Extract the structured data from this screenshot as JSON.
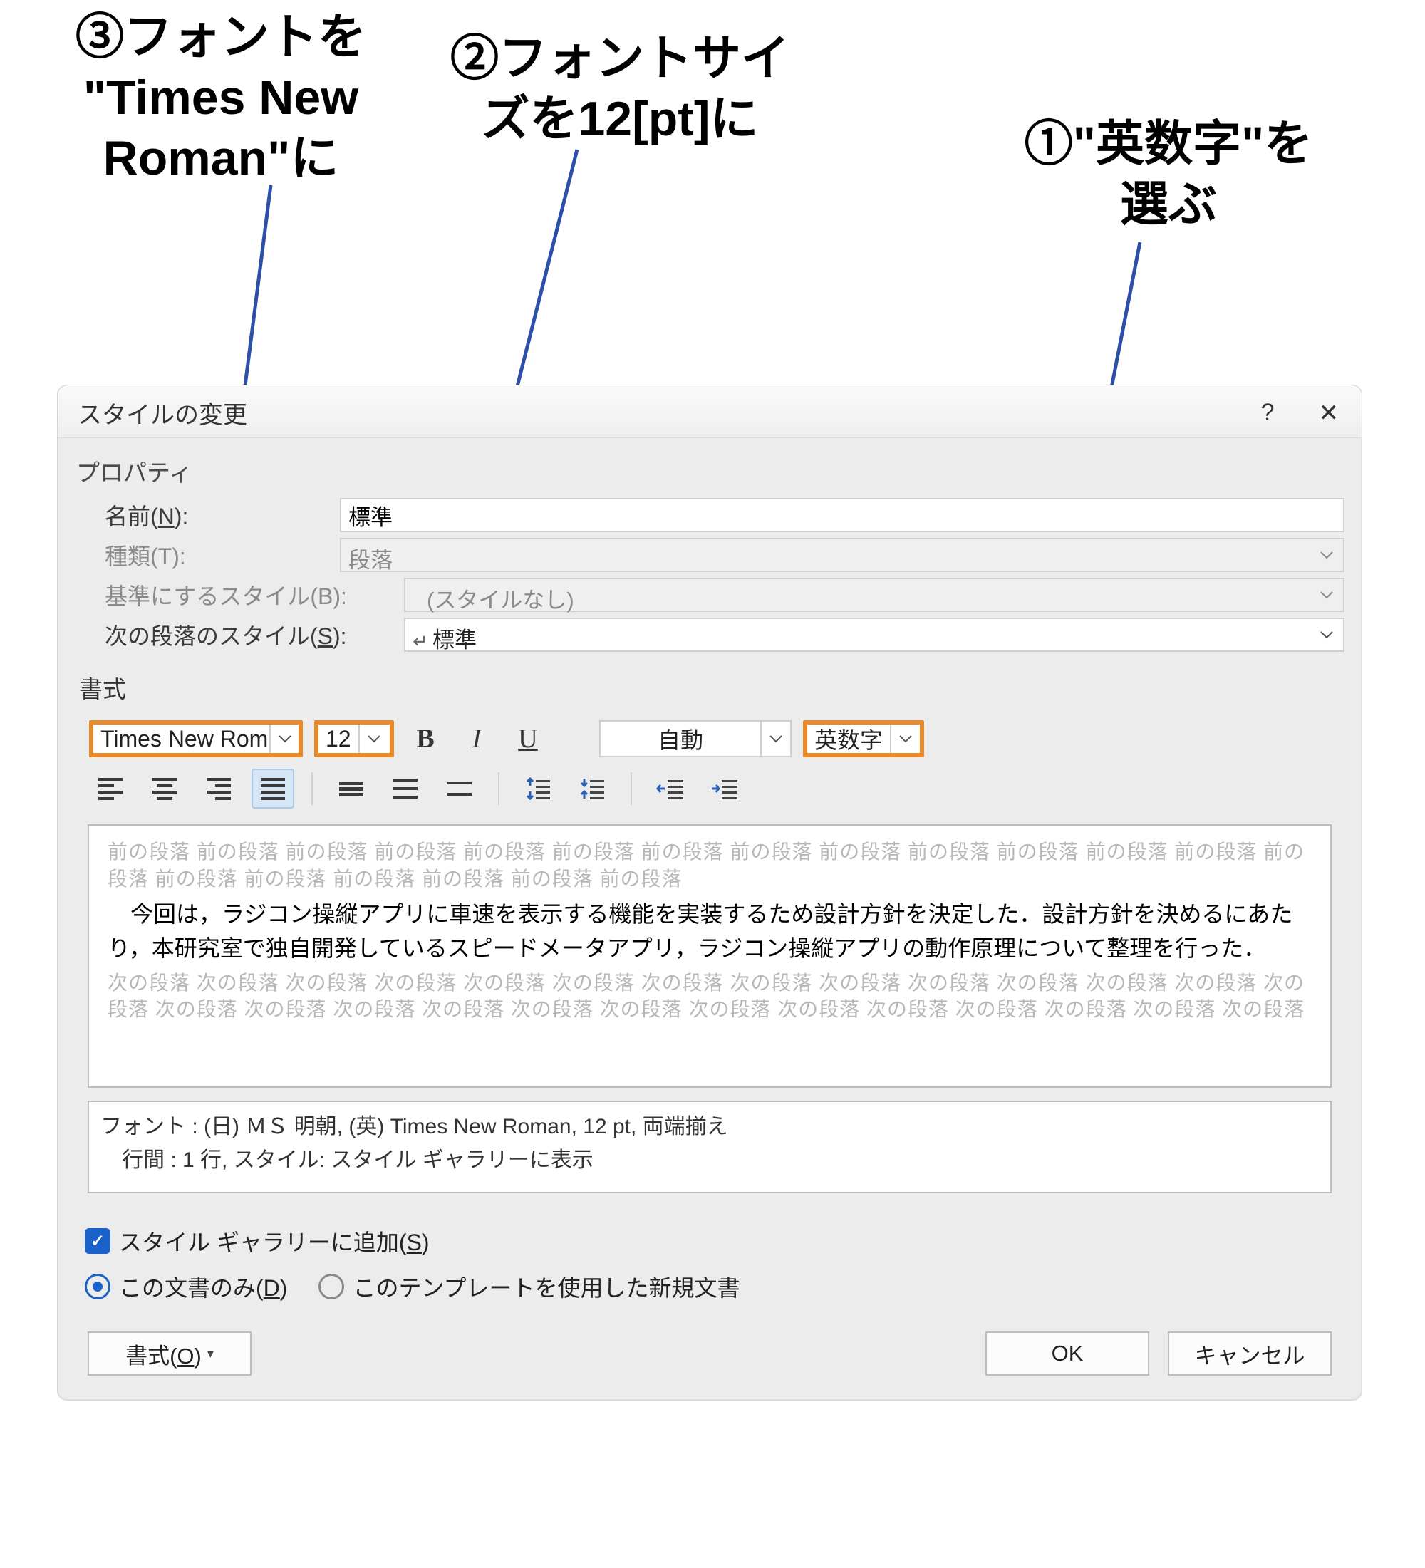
{
  "callouts": {
    "c3": "③フォントを\n\"Times New\nRoman\"に",
    "c2": "②フォントサイ\nズを12[pt]に",
    "c1": "①\"英数字\"を\n選ぶ"
  },
  "dialog": {
    "title": "スタイルの変更",
    "help": "?",
    "close": "✕"
  },
  "props": {
    "section": "プロパティ",
    "name_label_pre": "名前(",
    "name_label_u": "N",
    "name_label_post": "):",
    "name_value": "標準",
    "type_label": "種類(T):",
    "type_value": "段落",
    "base_label": "基準にするスタイル(B):",
    "base_value": "(スタイルなし)",
    "next_label_pre": "次の段落のスタイル(",
    "next_label_u": "S",
    "next_label_post": "):",
    "next_value": "標準",
    "para_icon": "↵"
  },
  "fmt": {
    "section": "書式",
    "font": "Times New Rom",
    "size": "12",
    "bold": "B",
    "italic": "I",
    "underline": "U",
    "color": "自動",
    "script": "英数字"
  },
  "preview": {
    "ghost_top": "前の段落 前の段落 前の段落 前の段落 前の段落 前の段落 前の段落 前の段落 前の段落 前の段落 前の段落 前の段落 前の段落 前の段落 前の段落 前の段落 前の段落 前の段落 前の段落 前の段落",
    "main": "　今回は，ラジコン操縦アプリに車速を表示する機能を実装するため設計方針を決定した．設計方針を決めるにあたり，本研究室で独自開発しているスピードメータアプリ，ラジコン操縦アプリの動作原理について整理を行った．",
    "ghost_bot": "次の段落 次の段落 次の段落 次の段落 次の段落 次の段落 次の段落 次の段落 次の段落 次の段落 次の段落 次の段落 次の段落 次の段落 次の段落 次の段落 次の段落 次の段落 次の段落 次の段落 次の段落 次の段落 次の段落 次の段落 次の段落 次の段落 次の段落"
  },
  "summary": {
    "line1": "フォント : (日) ＭＳ 明朝, (英) Times New Roman, 12 pt, 両端揃え",
    "line2": "　行間 :  1 行, スタイル: スタイル ギャラリーに表示"
  },
  "opts": {
    "add_pre": "スタイル ギャラリーに追加(",
    "add_u": "S",
    "add_post": ")",
    "doc_pre": "この文書のみ(",
    "doc_u": "D",
    "doc_post": ")",
    "tmpl": "このテンプレートを使用した新規文書"
  },
  "footer": {
    "format_pre": "書式(",
    "format_u": "O",
    "format_post": ")",
    "ok": "OK",
    "cancel": "キャンセル"
  }
}
